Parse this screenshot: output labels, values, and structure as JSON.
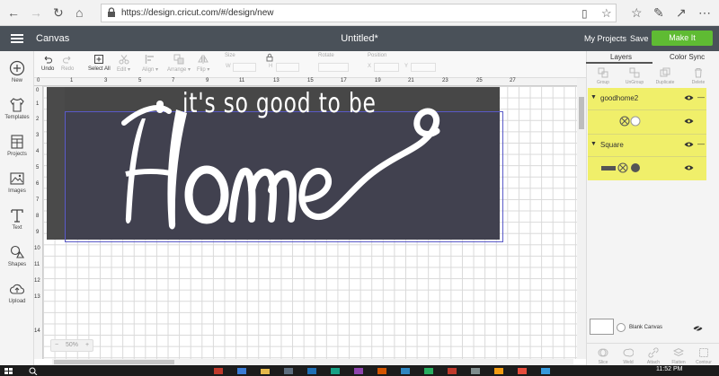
{
  "browser": {
    "url": "https://design.cricut.com/#/design/new",
    "icons": [
      "back-icon",
      "forward-icon",
      "refresh-icon",
      "home-icon",
      "lock-icon",
      "reader-icon",
      "favorite-star-icon",
      "hub-icon",
      "pen-icon",
      "share-icon",
      "more-icon"
    ]
  },
  "app": {
    "name": "Canvas",
    "document_title": "Untitled*",
    "my_projects": "My Projects",
    "save": "Save",
    "make_it": "Make It",
    "accent_color": "#5fbb33",
    "header_color": "#4a5159"
  },
  "leftnav": [
    {
      "label": "New",
      "icon": "plus-circle-icon"
    },
    {
      "label": "Templates",
      "icon": "shirt-icon"
    },
    {
      "label": "Projects",
      "icon": "projects-icon"
    },
    {
      "label": "Images",
      "icon": "image-icon"
    },
    {
      "label": "Text",
      "icon": "text-icon"
    },
    {
      "label": "Shapes",
      "icon": "shapes-icon"
    },
    {
      "label": "Upload",
      "icon": "upload-cloud-icon"
    }
  ],
  "toolbar": {
    "undo": "Undo",
    "redo": "Redo",
    "select_all": "Select All",
    "edit": "Edit",
    "align": "Align",
    "arrange": "Arrange",
    "flip": "Flip",
    "size": "Size",
    "size_w": "W",
    "size_h": "H",
    "rotate": "Rotate",
    "position": "Position",
    "pos_x": "X",
    "pos_y": "Y"
  },
  "rulers": {
    "top": [
      "0",
      "1",
      "3",
      "5",
      "7",
      "9",
      "11",
      "13",
      "15",
      "17",
      "19",
      "21",
      "23",
      "25",
      "27"
    ],
    "left": [
      "0",
      "1",
      "2",
      "3",
      "4",
      "5",
      "6",
      "7",
      "8",
      "9",
      "10",
      "11",
      "12",
      "13",
      "14"
    ]
  },
  "design": {
    "tagline": "it's so good to be",
    "headline": "Home",
    "background_color": "#41414f",
    "text_color": "#ffffff"
  },
  "zoom": {
    "minus": "−",
    "value": "50%",
    "plus": "+"
  },
  "right_panel": {
    "tab_layers": "Layers",
    "tab_color_sync": "Color Sync",
    "tools": [
      "Group",
      "UnGroup",
      "Duplicate",
      "Delete"
    ],
    "layers": [
      {
        "name": "goodhome2",
        "highlight": "#f0ef6a"
      },
      {
        "name": "Square",
        "highlight": "#f0ef6a"
      }
    ],
    "blank_canvas": "Blank Canvas",
    "bottom_tools": [
      "Slice",
      "Weld",
      "Attach",
      "Flatten",
      "Contour"
    ]
  },
  "taskbar": {
    "time": "11:52 PM"
  }
}
